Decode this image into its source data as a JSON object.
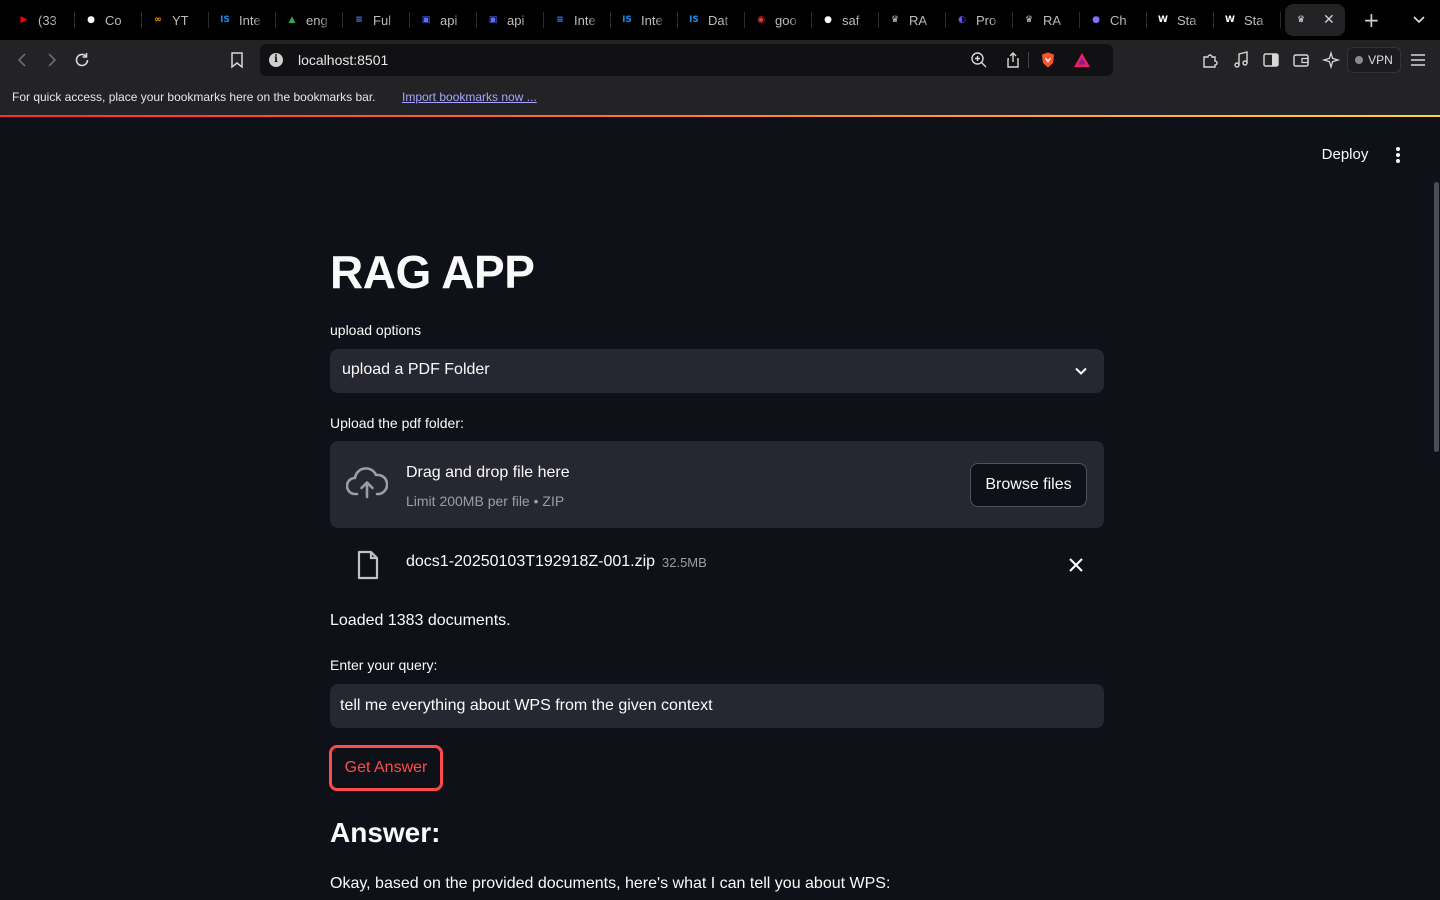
{
  "browser": {
    "tabs": [
      {
        "title": "(33",
        "icon": "youtube-icon",
        "color": "#ff0000",
        "glyph": "▶"
      },
      {
        "title": "Co",
        "icon": "github-icon",
        "color": "#ffffff",
        "glyph": "●"
      },
      {
        "title": "YT",
        "icon": "infinity-icon",
        "color": "#ff9d00",
        "glyph": "∞"
      },
      {
        "title": "Inte",
        "icon": "is-icon",
        "color": "#1e88e5",
        "glyph": "IS"
      },
      {
        "title": "eng",
        "icon": "drive-icon",
        "color": "#34a853",
        "glyph": "▲"
      },
      {
        "title": "Ful",
        "icon": "docs-icon",
        "color": "#4285f4",
        "glyph": "≡"
      },
      {
        "title": "api",
        "icon": "app-icon",
        "color": "#5b6cff",
        "glyph": "▣"
      },
      {
        "title": "api",
        "icon": "app-icon",
        "color": "#5b6cff",
        "glyph": "▣"
      },
      {
        "title": "Inte",
        "icon": "docs-icon",
        "color": "#4285f4",
        "glyph": "≡"
      },
      {
        "title": "Inte",
        "icon": "is-icon",
        "color": "#1e88e5",
        "glyph": "IS"
      },
      {
        "title": "Dat",
        "icon": "is-icon",
        "color": "#1e88e5",
        "glyph": "IS"
      },
      {
        "title": "goo",
        "icon": "target-icon",
        "color": "#e53935",
        "glyph": "◉"
      },
      {
        "title": "saf",
        "icon": "github-icon",
        "color": "#ffffff",
        "glyph": "●"
      },
      {
        "title": "RA",
        "icon": "streamlit-icon",
        "color": "#cfcfcf",
        "glyph": "♛"
      },
      {
        "title": "Pro",
        "icon": "proton-icon",
        "color": "#6d4aff",
        "glyph": "◐"
      },
      {
        "title": "RA",
        "icon": "streamlit-icon",
        "color": "#cfcfcf",
        "glyph": "♛"
      },
      {
        "title": "Ch",
        "icon": "chat-icon",
        "color": "#8e6bff",
        "glyph": "●"
      },
      {
        "title": "Sta",
        "icon": "wiki-icon",
        "color": "#ffffff",
        "glyph": "W"
      },
      {
        "title": "Sta",
        "icon": "wiki-icon",
        "color": "#ffffff",
        "glyph": "W"
      }
    ],
    "url": "localhost:8501",
    "vpn_label": "VPN",
    "bookmarks_message": "For quick access, place your bookmarks here on the bookmarks bar.",
    "bookmarks_link": "Import bookmarks now ..."
  },
  "app": {
    "deploy_label": "Deploy",
    "title": "RAG APP",
    "upload_options_label": "upload options",
    "upload_option_selected": "upload a PDF Folder",
    "upload_folder_label": "Upload the pdf folder:",
    "dropzone_title": "Drag and drop file here",
    "dropzone_limit": "Limit 200MB per file • ZIP",
    "browse_label": "Browse files",
    "file_name": "docs1-20250103T192918Z-001.zip",
    "file_size": "32.5MB",
    "status": "Loaded 1383 documents.",
    "query_label": "Enter your query:",
    "query_value": "tell me everything about WPS from the given context",
    "get_answer_label": "Get Answer",
    "answer_heading": "Answer:",
    "answer_text": "Okay, based on the provided documents, here's what I can tell you about WPS:"
  },
  "colors": {
    "background": "#0e1117",
    "widget": "#262730",
    "accent": "#ff4b4b",
    "text": "#fafafa",
    "muted": "#9c9ea6"
  }
}
